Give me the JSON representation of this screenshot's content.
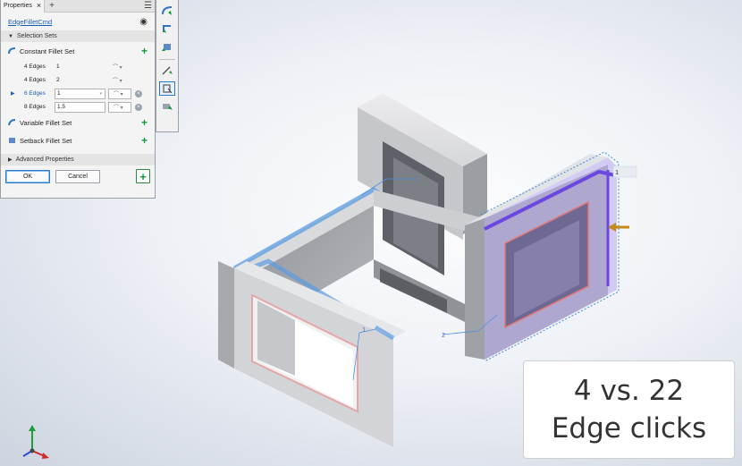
{
  "panel": {
    "tab_label": "Properties",
    "command_name": "EdgeFilletCmd",
    "selection_sets_header": "Selection Sets",
    "constant_set_label": "Constant Fillet Set",
    "edge_rows": [
      {
        "label": "4 Edges",
        "value": "1"
      },
      {
        "label": "4 Edges",
        "value": "2"
      },
      {
        "label": "6 Edges",
        "value": "1"
      },
      {
        "label": "8 Edges",
        "value": "1.5"
      }
    ],
    "variable_set_label": "Variable Fillet Set",
    "setback_set_label": "Setback Fillet Set",
    "advanced_properties_label": "Advanced Properties",
    "ok_label": "OK",
    "cancel_label": "Cancel"
  },
  "toolbar": {
    "buttons": [
      "fillet-edge-icon",
      "fillet-face-icon",
      "fillet-full-round-icon",
      "select-edge-icon",
      "select-loop-icon",
      "select-feature-icon"
    ]
  },
  "model": {
    "radius_tags": [
      "1",
      "1",
      "2"
    ]
  },
  "caption": {
    "line1": "4 vs. 22",
    "line2": "Edge clicks"
  },
  "colors": {
    "selection_blue": "#5b9be0",
    "highlight_purple": "#7a5ce6",
    "preview_red": "#e07878",
    "arrow_orange": "#c68a1a"
  }
}
